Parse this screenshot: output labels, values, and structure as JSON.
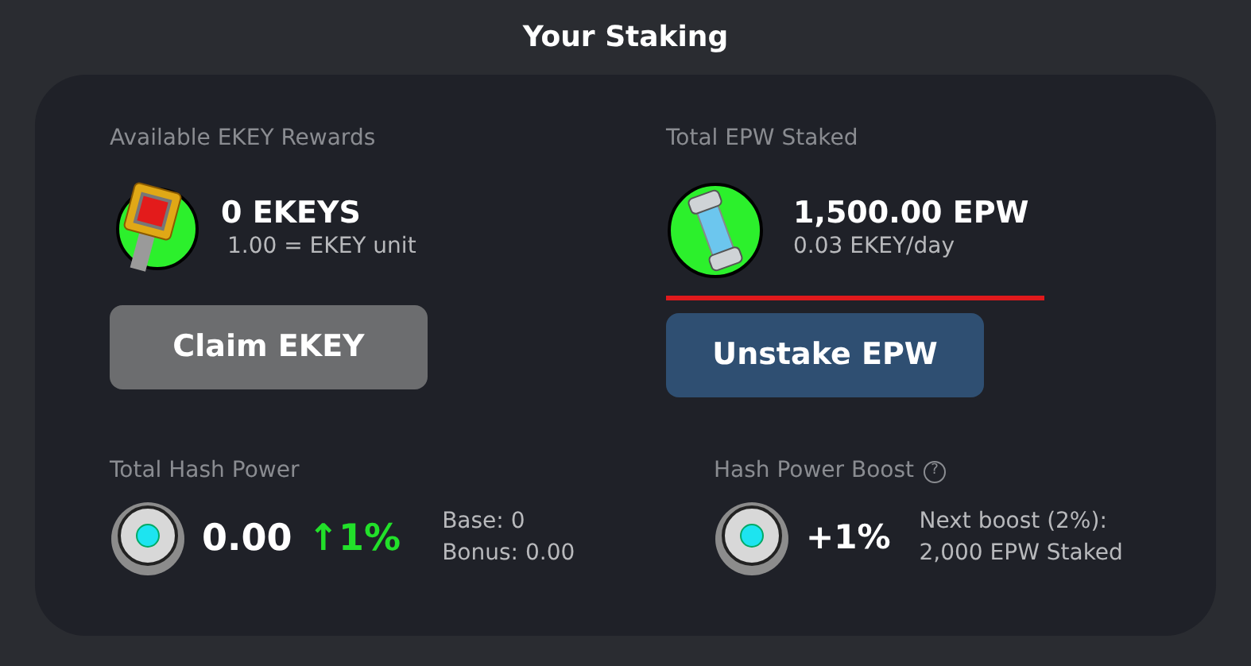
{
  "title": "Your Staking",
  "rewards": {
    "label": "Available EKEY Rewards",
    "amount": "0 EKEYS",
    "sub": "1.00 = EKEY unit",
    "button": {
      "label": "Claim EKEY",
      "disabled": true
    }
  },
  "staked": {
    "label": "Total EPW Staked",
    "amount": "1,500.00 EPW",
    "sub": "0.03 EKEY/day",
    "button": {
      "label": "Unstake EPW",
      "disabled": false
    }
  },
  "hash_power": {
    "label": "Total Hash Power",
    "value": "0.00",
    "change": "↑1%",
    "base": "Base: 0",
    "bonus": "Bonus: 0.00"
  },
  "boost": {
    "label": "Hash Power Boost",
    "help": "?",
    "value": "+1%",
    "next": "Next boost (2%):",
    "requirement": "2,000 EPW Staked"
  }
}
